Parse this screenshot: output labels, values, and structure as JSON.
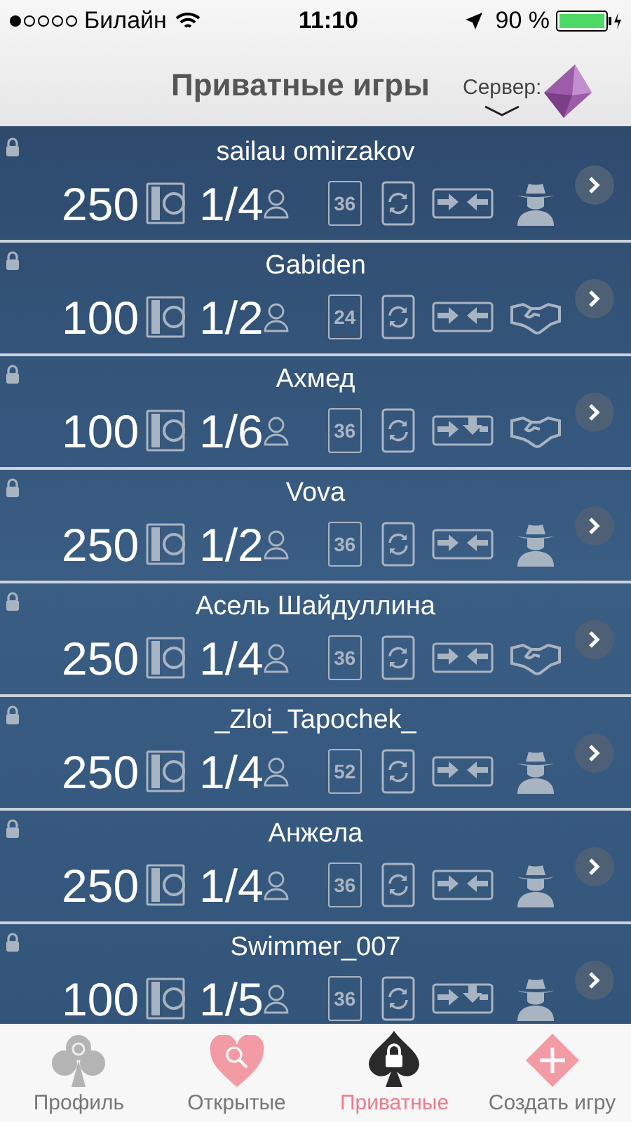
{
  "status_bar": {
    "carrier": "Билайн",
    "time": "11:10",
    "battery": "90 %"
  },
  "header": {
    "title": "Приватные игры",
    "server_label": "Сервер:"
  },
  "games": [
    {
      "name": "sailau omirzakov",
      "bet": "250",
      "players": "1/4",
      "deck": "36",
      "throw_from_top": false,
      "cheating": true
    },
    {
      "name": "Gabiden",
      "bet": "100",
      "players": "1/2",
      "deck": "24",
      "throw_from_top": false,
      "cheating": false
    },
    {
      "name": "Ахмед",
      "bet": "100",
      "players": "1/6",
      "deck": "36",
      "throw_from_top": true,
      "cheating": false
    },
    {
      "name": "Vova",
      "bet": "250",
      "players": "1/2",
      "deck": "36",
      "throw_from_top": false,
      "cheating": true
    },
    {
      "name": "Асель Шайдуллина",
      "bet": "250",
      "players": "1/4",
      "deck": "36",
      "throw_from_top": false,
      "cheating": false
    },
    {
      "name": "_Zloi_Tapochek_",
      "bet": "250",
      "players": "1/4",
      "deck": "52",
      "throw_from_top": false,
      "cheating": true
    },
    {
      "name": "Анжела",
      "bet": "250",
      "players": "1/4",
      "deck": "36",
      "throw_from_top": false,
      "cheating": true
    },
    {
      "name": "Swimmer_007",
      "bet": "100",
      "players": "1/5",
      "deck": "36",
      "throw_from_top": true,
      "cheating": true
    }
  ],
  "tabs": [
    {
      "label": "Профиль",
      "kind": "club",
      "selected": false
    },
    {
      "label": "Открытые",
      "kind": "heart",
      "selected": false
    },
    {
      "label": "Приватные",
      "kind": "spade",
      "selected": true
    },
    {
      "label": "Создать игру",
      "kind": "diamond",
      "selected": false
    }
  ]
}
